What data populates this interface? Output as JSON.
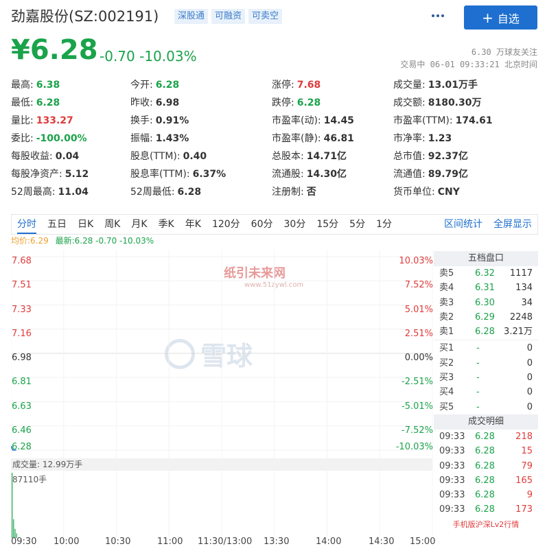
{
  "header": {
    "stock_name": "劲嘉股份(SZ:002191)",
    "tags": [
      "深股通",
      "可融资",
      "可卖空"
    ],
    "follow_label": "自选"
  },
  "price": {
    "current": "¥6.28",
    "change": "-0.70 -10.03%",
    "followers": "6.30 万球友关注",
    "status": "交易中 06-01 09:33:21 北京时间"
  },
  "quote": [
    [
      {
        "label": "最高:",
        "value": "6.38",
        "tone": "down"
      },
      {
        "label": "今开:",
        "value": "6.28",
        "tone": "down"
      },
      {
        "label": "涨停:",
        "value": "7.68",
        "tone": "up"
      },
      {
        "label": "成交量:",
        "value": "13.01万手",
        "tone": "flat"
      }
    ],
    [
      {
        "label": "最低:",
        "value": "6.28",
        "tone": "down"
      },
      {
        "label": "昨收:",
        "value": "6.98",
        "tone": "flat"
      },
      {
        "label": "跌停:",
        "value": "6.28",
        "tone": "down"
      },
      {
        "label": "成交额:",
        "value": "8180.30万",
        "tone": "flat"
      }
    ],
    [
      {
        "label": "量比:",
        "value": "133.27",
        "tone": "up"
      },
      {
        "label": "换手:",
        "value": "0.91%",
        "tone": "flat"
      },
      {
        "label": "市盈率(动):",
        "value": "14.45",
        "tone": "flat"
      },
      {
        "label": "市盈率(TTM):",
        "value": "174.61",
        "tone": "flat"
      }
    ],
    [
      {
        "label": "委比:",
        "value": "-100.00%",
        "tone": "down"
      },
      {
        "label": "振幅:",
        "value": "1.43%",
        "tone": "flat"
      },
      {
        "label": "市盈率(静):",
        "value": "46.81",
        "tone": "flat"
      },
      {
        "label": "市净率:",
        "value": "1.23",
        "tone": "flat"
      }
    ],
    [
      {
        "label": "每股收益:",
        "value": "0.04",
        "tone": "flat"
      },
      {
        "label": "股息(TTM):",
        "value": "0.40",
        "tone": "flat"
      },
      {
        "label": "总股本:",
        "value": "14.71亿",
        "tone": "flat"
      },
      {
        "label": "总市值:",
        "value": "92.37亿",
        "tone": "flat"
      }
    ],
    [
      {
        "label": "每股净资产:",
        "value": "5.12",
        "tone": "flat"
      },
      {
        "label": "股息率(TTM):",
        "value": "6.37%",
        "tone": "flat"
      },
      {
        "label": "流通股:",
        "value": "14.30亿",
        "tone": "flat"
      },
      {
        "label": "流通值:",
        "value": "89.79亿",
        "tone": "flat"
      }
    ],
    [
      {
        "label": "52周最高:",
        "value": "11.04",
        "tone": "flat"
      },
      {
        "label": "52周最低:",
        "value": "6.28",
        "tone": "flat"
      },
      {
        "label": "注册制:",
        "value": "否",
        "tone": "flat"
      },
      {
        "label": "货币单位:",
        "value": "CNY",
        "tone": "flat"
      }
    ]
  ],
  "period_tabs": [
    "分时",
    "五日",
    "日K",
    "周K",
    "月K",
    "季K",
    "年K",
    "120分",
    "60分",
    "30分",
    "15分",
    "5分",
    "1分"
  ],
  "period_actions": [
    "区间统计",
    "全屏显示"
  ],
  "legend": {
    "avg": "均价:6.29",
    "latest": "最新:6.28 -0.70 -10.03%"
  },
  "watermark": {
    "xueqiu": "雪球",
    "zy1": "纸引未来网",
    "zy2": "www.51zywl.com"
  },
  "chart_data": {
    "type": "line",
    "price_axis": [
      "7.68",
      "7.51",
      "7.33",
      "7.16",
      "6.98",
      "6.81",
      "6.63",
      "6.46",
      "6.28"
    ],
    "pct_axis": [
      "10.03%",
      "7.52%",
      "5.01%",
      "2.51%",
      "0.00%",
      "-2.51%",
      "-5.01%",
      "-7.52%",
      "-10.03%"
    ],
    "ylim": [
      6.28,
      7.68
    ],
    "prev_close": 6.98,
    "x_ticks": [
      "09:30",
      "10:00",
      "10:30",
      "11:00",
      "11:30/13:00",
      "13:30",
      "14:00",
      "14:30",
      "15:00"
    ],
    "price_series": [
      6.31,
      6.28,
      6.28,
      6.28
    ],
    "volume_label": "成交量: 12.99万手",
    "volume_max_label": "87110手",
    "volume_bars": [
      87110,
      25000,
      12000,
      6000
    ]
  },
  "order_book": {
    "title": "五档盘口",
    "rows": [
      {
        "name": "卖5",
        "price": "6.32",
        "vol": "1117"
      },
      {
        "name": "卖4",
        "price": "6.31",
        "vol": "134"
      },
      {
        "name": "卖3",
        "price": "6.30",
        "vol": "34"
      },
      {
        "name": "卖2",
        "price": "6.29",
        "vol": "2248"
      },
      {
        "name": "卖1",
        "price": "6.28",
        "vol": "3.21万"
      },
      {
        "name": "买1",
        "price": "-",
        "vol": "0"
      },
      {
        "name": "买2",
        "price": "-",
        "vol": "0"
      },
      {
        "name": "买3",
        "price": "-",
        "vol": "0"
      },
      {
        "name": "买4",
        "price": "-",
        "vol": "0"
      },
      {
        "name": "买5",
        "price": "-",
        "vol": "0"
      }
    ]
  },
  "trades": {
    "title": "成交明细",
    "rows": [
      {
        "time": "09:33",
        "price": "6.28",
        "vol": "218"
      },
      {
        "time": "09:33",
        "price": "6.28",
        "vol": "15"
      },
      {
        "time": "09:33",
        "price": "6.28",
        "vol": "79"
      },
      {
        "time": "09:33",
        "price": "6.28",
        "vol": "165"
      },
      {
        "time": "09:33",
        "price": "6.28",
        "vol": "9"
      },
      {
        "time": "09:33",
        "price": "6.28",
        "vol": "173"
      }
    ],
    "footer": "手机版沪深Lv2行情"
  },
  "colors": {
    "up": "#e03a3a",
    "down": "#1aa34a",
    "accent": "#1e6fcf",
    "avg": "#f0a030"
  }
}
